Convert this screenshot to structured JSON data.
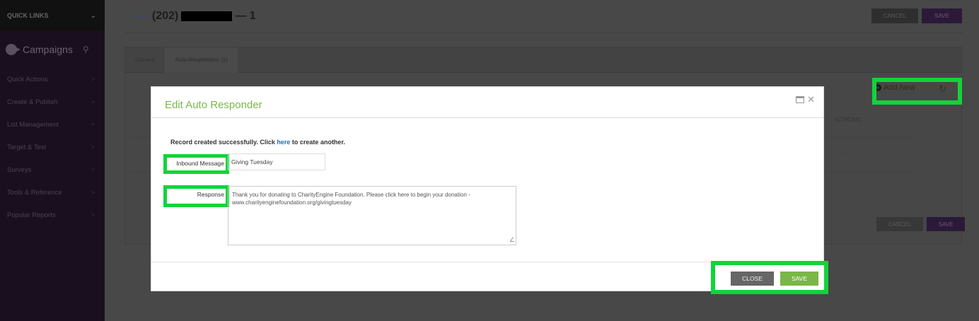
{
  "sidebar": {
    "quick_links": "QUICK LINKS",
    "section_title": "Campaigns",
    "items": [
      {
        "label": "Quick Actions"
      },
      {
        "label": "Create & Publish"
      },
      {
        "label": "List Management"
      },
      {
        "label": "Target & Test"
      },
      {
        "label": "Surveys"
      },
      {
        "label": "Tools & Reference"
      },
      {
        "label": "Popular Reports"
      }
    ]
  },
  "header": {
    "back_label": "back",
    "title_prefix": "(202)",
    "title_suffix": "— 1",
    "cancel_label": "CANCEL",
    "save_label": "SAVE"
  },
  "tabs": [
    {
      "label": "General"
    },
    {
      "label": "Auto-Responders (1)"
    }
  ],
  "list": {
    "add_new_label": "Add New",
    "actions_header": "ACTIONS",
    "row_menu": "···",
    "cancel_label": "CANCEL",
    "save_label": "SAVE"
  },
  "modal": {
    "title": "Edit Auto Responder",
    "success_prefix": "Record created successfully. Click ",
    "success_link": "here",
    "success_suffix": " to create another.",
    "inbound_label": "Inbound Message",
    "inbound_value": "Giving Tuesday",
    "response_label": "Response",
    "response_value": "Thank you for donating to CharityEngine Foundation. Please click here to begin your donation - www.charityenginefoundation.org/givingtuesday",
    "close_label": "CLOSE",
    "save_label": "SAVE"
  },
  "colors": {
    "accent_green": "#7ab648",
    "highlight": "#11d43b",
    "link_blue": "#1f6fb3"
  }
}
